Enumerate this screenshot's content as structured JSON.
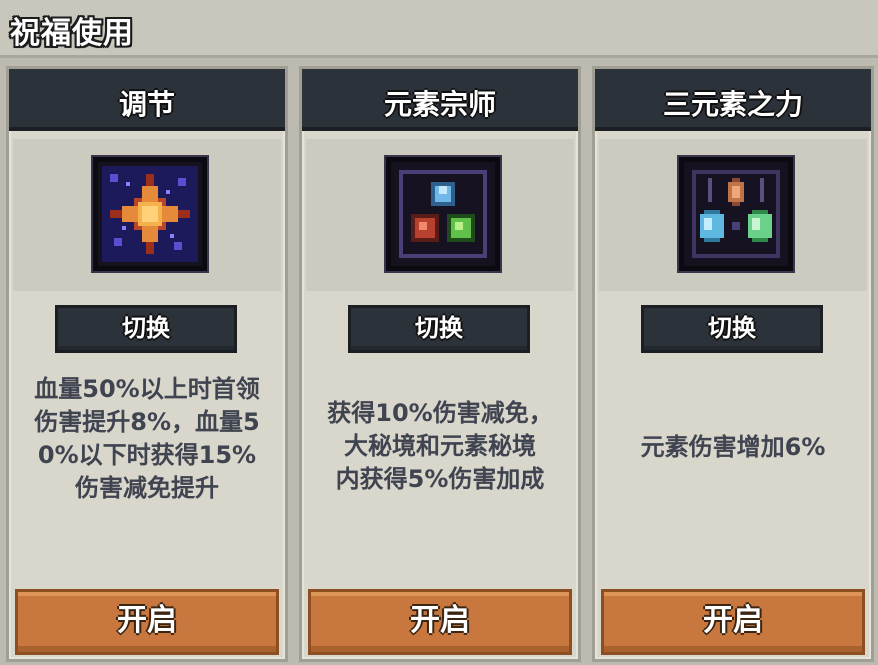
{
  "header": {
    "title": "祝福使用"
  },
  "cards": [
    {
      "title": "调节",
      "icon": "radiant-star-icon",
      "switch_label": "切换",
      "description_lines": [
        "血量50%以上时首领",
        "伤害提升8%，血量5",
        "0%以下时获得15%",
        "伤害减免提升"
      ],
      "open_label": "开启"
    },
    {
      "title": "元素宗师",
      "icon": "three-element-orbs-icon",
      "switch_label": "切换",
      "description_lines": [
        "获得10%伤害减免，",
        "大秘境和元素秘境",
        "内获得5%伤害加成"
      ],
      "open_label": "开启"
    },
    {
      "title": "三元素之力",
      "icon": "three-element-crystals-icon",
      "switch_label": "切换",
      "description_lines": [
        "元素伤害增加6%"
      ],
      "open_label": "开启"
    }
  ],
  "colors": {
    "panel_dark": "#2c3239",
    "button_orange": "#c8783e",
    "card_bg": "#d9d6cb",
    "text_gray": "#3f4450"
  }
}
